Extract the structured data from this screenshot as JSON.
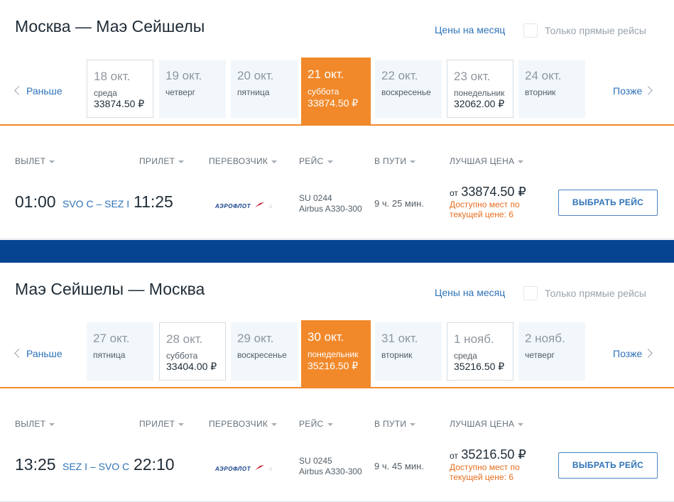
{
  "colors": {
    "accent": "#f1892b",
    "link": "#2f73b8",
    "brand_band": "#064491",
    "warning": "#e66e1f"
  },
  "ui": {
    "month_link": "Цены на месяц",
    "direct_only": "Только прямые рейсы",
    "prev": "Раньше",
    "next": "Позже",
    "select_button": "ВЫБРАТЬ РЕЙС",
    "price_from": "от",
    "seats_note": "Доступно мест по текущей цене: 6",
    "columns": {
      "departure": "ВЫЛЕТ",
      "arrival": "ПРИЛЕТ",
      "carrier": "ПЕРЕВОЗЧИК",
      "flight": "РЕЙС",
      "duration": "В ПУТИ",
      "best_price": "ЛУЧШАЯ ЦЕНА"
    },
    "airline_logo_text": "АЭРОФЛОТ"
  },
  "sections": [
    {
      "title": "Москва — Маэ Сейшелы",
      "dates": [
        {
          "date": "18 окт.",
          "weekday": "среда",
          "price": "33874.50 ₽",
          "state": "bordered"
        },
        {
          "date": "19 окт.",
          "weekday": "четверг",
          "price": "",
          "state": "plain"
        },
        {
          "date": "20 окт.",
          "weekday": "пятница",
          "price": "",
          "state": "plain"
        },
        {
          "date": "21 окт.",
          "weekday": "суббота",
          "price": "33874.50 ₽",
          "state": "active"
        },
        {
          "date": "22 окт.",
          "weekday": "воскресенье",
          "price": "",
          "state": "plain"
        },
        {
          "date": "23 окт.",
          "weekday": "понедельник",
          "price": "32062.00 ₽",
          "state": "bordered"
        },
        {
          "date": "24 окт.",
          "weekday": "вторник",
          "price": "",
          "state": "plain"
        }
      ],
      "flight": {
        "departure_time": "01:00",
        "airports": "SVO C – SEZ I",
        "arrival_time": "11:25",
        "flight_number": "SU 0244",
        "aircraft": "Airbus A330-300",
        "duration": "9 ч. 25 мин.",
        "price": "33874.50 ₽"
      }
    },
    {
      "title": "Маэ Сейшелы — Москва",
      "dates": [
        {
          "date": "27 окт.",
          "weekday": "пятница",
          "price": "",
          "state": "plain"
        },
        {
          "date": "28 окт.",
          "weekday": "суббота",
          "price": "33404.00 ₽",
          "state": "bordered"
        },
        {
          "date": "29 окт.",
          "weekday": "воскресенье",
          "price": "",
          "state": "plain"
        },
        {
          "date": "30 окт.",
          "weekday": "понедельник",
          "price": "35216.50 ₽",
          "state": "active"
        },
        {
          "date": "31 окт.",
          "weekday": "вторник",
          "price": "",
          "state": "plain"
        },
        {
          "date": "1 нояб.",
          "weekday": "среда",
          "price": "35216.50 ₽",
          "state": "bordered"
        },
        {
          "date": "2 нояб.",
          "weekday": "четверг",
          "price": "",
          "state": "plain"
        }
      ],
      "flight": {
        "departure_time": "13:25",
        "airports": "SEZ I – SVO C",
        "arrival_time": "22:10",
        "flight_number": "SU 0245",
        "aircraft": "Airbus A330-300",
        "duration": "9 ч. 45 мин.",
        "price": "35216.50 ₽"
      }
    }
  ]
}
